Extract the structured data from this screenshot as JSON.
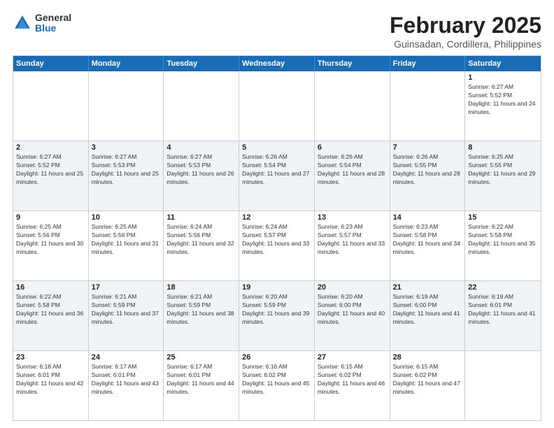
{
  "logo": {
    "general": "General",
    "blue": "Blue"
  },
  "title": {
    "month": "February 2025",
    "location": "Guinsadan, Cordillera, Philippines"
  },
  "headers": [
    "Sunday",
    "Monday",
    "Tuesday",
    "Wednesday",
    "Thursday",
    "Friday",
    "Saturday"
  ],
  "rows": [
    [
      {
        "day": "",
        "info": ""
      },
      {
        "day": "",
        "info": ""
      },
      {
        "day": "",
        "info": ""
      },
      {
        "day": "",
        "info": ""
      },
      {
        "day": "",
        "info": ""
      },
      {
        "day": "",
        "info": ""
      },
      {
        "day": "1",
        "info": "Sunrise: 6:27 AM\nSunset: 5:52 PM\nDaylight: 11 hours and 24 minutes."
      }
    ],
    [
      {
        "day": "2",
        "info": "Sunrise: 6:27 AM\nSunset: 5:52 PM\nDaylight: 11 hours and 25 minutes."
      },
      {
        "day": "3",
        "info": "Sunrise: 6:27 AM\nSunset: 5:53 PM\nDaylight: 11 hours and 25 minutes."
      },
      {
        "day": "4",
        "info": "Sunrise: 6:27 AM\nSunset: 5:53 PM\nDaylight: 11 hours and 26 minutes."
      },
      {
        "day": "5",
        "info": "Sunrise: 6:26 AM\nSunset: 5:54 PM\nDaylight: 11 hours and 27 minutes."
      },
      {
        "day": "6",
        "info": "Sunrise: 6:26 AM\nSunset: 5:54 PM\nDaylight: 11 hours and 28 minutes."
      },
      {
        "day": "7",
        "info": "Sunrise: 6:26 AM\nSunset: 5:55 PM\nDaylight: 11 hours and 28 minutes."
      },
      {
        "day": "8",
        "info": "Sunrise: 6:25 AM\nSunset: 5:55 PM\nDaylight: 11 hours and 29 minutes."
      }
    ],
    [
      {
        "day": "9",
        "info": "Sunrise: 6:25 AM\nSunset: 5:56 PM\nDaylight: 11 hours and 30 minutes."
      },
      {
        "day": "10",
        "info": "Sunrise: 6:25 AM\nSunset: 5:56 PM\nDaylight: 11 hours and 31 minutes."
      },
      {
        "day": "11",
        "info": "Sunrise: 6:24 AM\nSunset: 5:56 PM\nDaylight: 11 hours and 32 minutes."
      },
      {
        "day": "12",
        "info": "Sunrise: 6:24 AM\nSunset: 5:57 PM\nDaylight: 11 hours and 33 minutes."
      },
      {
        "day": "13",
        "info": "Sunrise: 6:23 AM\nSunset: 5:57 PM\nDaylight: 11 hours and 33 minutes."
      },
      {
        "day": "14",
        "info": "Sunrise: 6:23 AM\nSunset: 5:58 PM\nDaylight: 11 hours and 34 minutes."
      },
      {
        "day": "15",
        "info": "Sunrise: 6:22 AM\nSunset: 5:58 PM\nDaylight: 11 hours and 35 minutes."
      }
    ],
    [
      {
        "day": "16",
        "info": "Sunrise: 6:22 AM\nSunset: 5:58 PM\nDaylight: 11 hours and 36 minutes."
      },
      {
        "day": "17",
        "info": "Sunrise: 6:21 AM\nSunset: 5:59 PM\nDaylight: 11 hours and 37 minutes."
      },
      {
        "day": "18",
        "info": "Sunrise: 6:21 AM\nSunset: 5:59 PM\nDaylight: 11 hours and 38 minutes."
      },
      {
        "day": "19",
        "info": "Sunrise: 6:20 AM\nSunset: 5:59 PM\nDaylight: 11 hours and 39 minutes."
      },
      {
        "day": "20",
        "info": "Sunrise: 6:20 AM\nSunset: 6:00 PM\nDaylight: 11 hours and 40 minutes."
      },
      {
        "day": "21",
        "info": "Sunrise: 6:19 AM\nSunset: 6:00 PM\nDaylight: 11 hours and 41 minutes."
      },
      {
        "day": "22",
        "info": "Sunrise: 6:19 AM\nSunset: 6:01 PM\nDaylight: 11 hours and 41 minutes."
      }
    ],
    [
      {
        "day": "23",
        "info": "Sunrise: 6:18 AM\nSunset: 6:01 PM\nDaylight: 11 hours and 42 minutes."
      },
      {
        "day": "24",
        "info": "Sunrise: 6:17 AM\nSunset: 6:01 PM\nDaylight: 11 hours and 43 minutes."
      },
      {
        "day": "25",
        "info": "Sunrise: 6:17 AM\nSunset: 6:01 PM\nDaylight: 11 hours and 44 minutes."
      },
      {
        "day": "26",
        "info": "Sunrise: 6:16 AM\nSunset: 6:02 PM\nDaylight: 11 hours and 45 minutes."
      },
      {
        "day": "27",
        "info": "Sunrise: 6:15 AM\nSunset: 6:02 PM\nDaylight: 11 hours and 46 minutes."
      },
      {
        "day": "28",
        "info": "Sunrise: 6:15 AM\nSunset: 6:02 PM\nDaylight: 11 hours and 47 minutes."
      },
      {
        "day": "",
        "info": ""
      }
    ]
  ]
}
